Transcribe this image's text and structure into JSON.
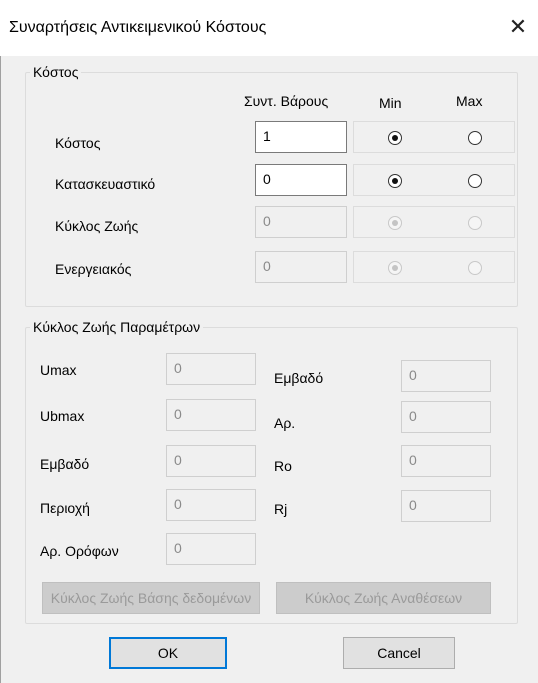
{
  "window": {
    "title": "Συναρτήσεις Αντικειμενικού Κόστους",
    "close_glyph": "✕"
  },
  "cost_group": {
    "label": "Κόστος",
    "headers": {
      "weight": "Συντ. Βάρους",
      "min": "Min",
      "max": "Max"
    },
    "rows": [
      {
        "label": "Κόστος",
        "value": "1",
        "enabled": true,
        "selected": "min"
      },
      {
        "label": "Κατασκευαστικό",
        "value": "0",
        "enabled": true,
        "selected": "min"
      },
      {
        "label": "Κύκλος Ζωής",
        "value": "0",
        "enabled": false,
        "selected": "min"
      },
      {
        "label": "Ενεργειακός",
        "value": "0",
        "enabled": false,
        "selected": "min"
      }
    ]
  },
  "lifecycle_group": {
    "label": "Κύκλος Ζωής Παραμέτρων",
    "left_fields": [
      {
        "label": "Umax",
        "value": "0"
      },
      {
        "label": "Ubmax",
        "value": "0"
      },
      {
        "label": "Εμβαδό",
        "value": "0"
      },
      {
        "label": "Περιοχή",
        "value": "0"
      },
      {
        "label": "Αρ. Ορόφων",
        "value": "0"
      }
    ],
    "right_fields": [
      {
        "label": "Εμβαδό",
        "value": "0"
      },
      {
        "label": "Αρ.",
        "value": "0"
      },
      {
        "label": "Ro",
        "value": "0"
      },
      {
        "label": "Rj",
        "value": "0"
      }
    ],
    "db_button": "Κύκλος Ζωής Βάσης δεδομένων",
    "tenders_button": "Κύκλος Ζωής Αναθέσεων"
  },
  "footer": {
    "ok": "OK",
    "cancel": "Cancel"
  }
}
